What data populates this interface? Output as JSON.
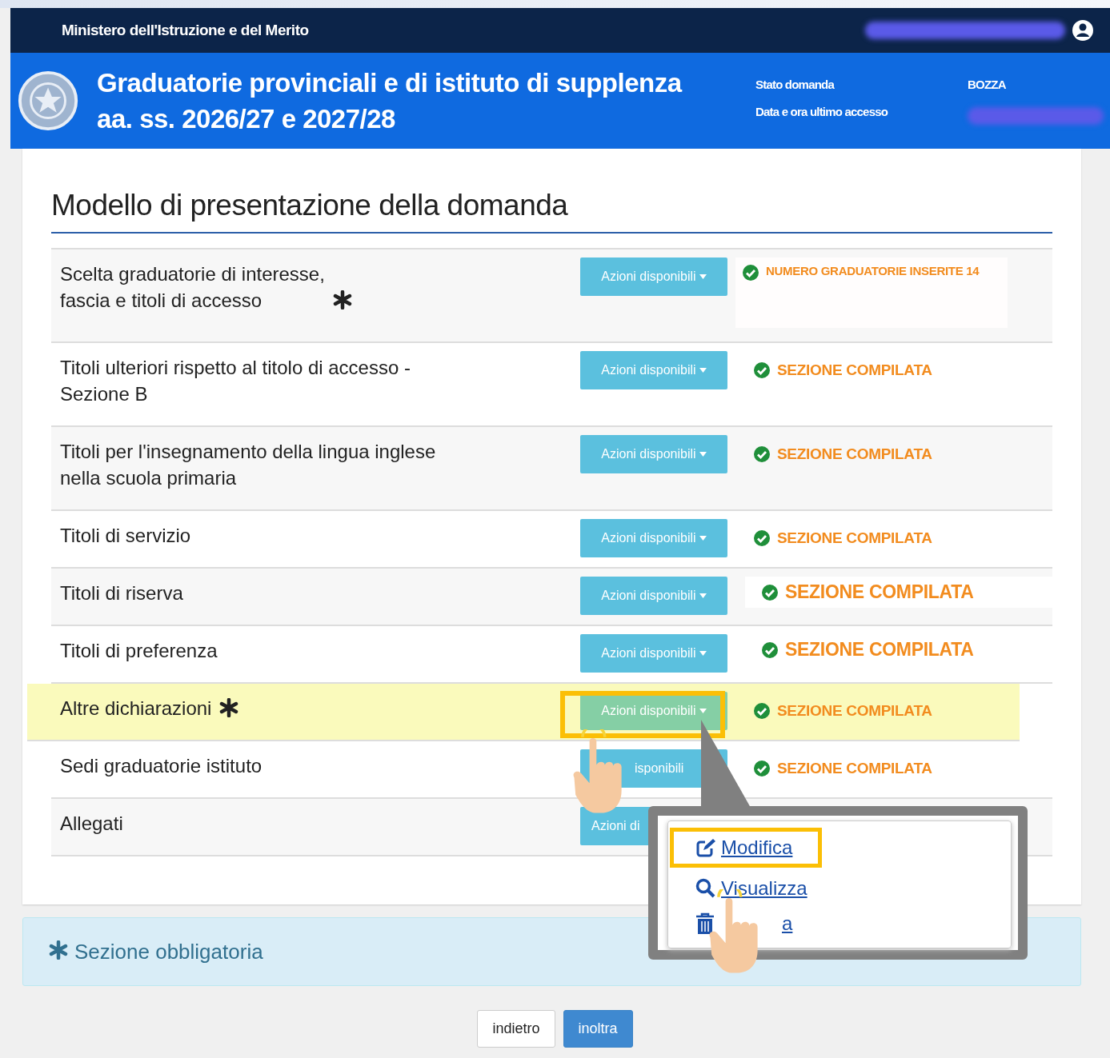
{
  "header": {
    "ministry": "Ministero dell'Istruzione e del Merito",
    "title_lines": [
      "Graduatorie provinciali e di istituto di supplenza",
      "aa. ss. 2026/27 e 2027/28"
    ],
    "status_label": "Stato domanda",
    "status_value": "BOZZA",
    "access_label": "Data e ora ultimo accesso"
  },
  "page_title": "Modello di presentazione della domanda",
  "rows": [
    {
      "label": "Scelta graduatorie di interesse,\nfascia e titoli di accesso",
      "required": true,
      "highlighted": false,
      "button_label": "Azioni disponibili",
      "status": "NUMERO GRADUATORIE INSERITE 14",
      "kind": "count"
    },
    {
      "label": "Titoli ulteriori rispetto al titolo di accesso -\nSezione B",
      "required": false,
      "highlighted": false,
      "button_label": "Azioni disponibili",
      "status": "SEZIONE COMPILATA",
      "kind": "normal"
    },
    {
      "label": "Titoli per l'insegnamento della lingua inglese\nnella scuola primaria",
      "required": false,
      "highlighted": false,
      "button_label": "Azioni disponibili",
      "status": "SEZIONE COMPILATA",
      "kind": "normal"
    },
    {
      "label": "Titoli di servizio",
      "required": false,
      "highlighted": false,
      "button_label": "Azioni disponibili",
      "status": "SEZIONE COMPILATA",
      "kind": "normal"
    },
    {
      "label": "Titoli di riserva",
      "required": false,
      "highlighted": false,
      "button_label": "Azioni disponibili",
      "status": "SEZIONE COMPILATA",
      "kind": "large"
    },
    {
      "label": "Titoli di preferenza",
      "required": false,
      "highlighted": false,
      "button_label": "Azioni disponibili",
      "status": "SEZIONE COMPILATA",
      "kind": "large"
    },
    {
      "label": "Altre dichiarazioni",
      "required": true,
      "highlighted": true,
      "button_label": "Azioni disponibili",
      "status": "SEZIONE COMPILATA",
      "kind": "normal"
    },
    {
      "label": "Sedi graduatorie istituto",
      "required": false,
      "highlighted": false,
      "button_label": "isponibili",
      "status": "SEZIONE COMPILATA",
      "kind": "normal"
    },
    {
      "label": "Allegati",
      "required": false,
      "highlighted": false,
      "button_label": "Azioni di"
    }
  ],
  "callout": {
    "items": [
      {
        "label": "Modifica",
        "highlighted": true
      },
      {
        "label": "Visualizza",
        "highlighted": false
      },
      {
        "label": "a",
        "highlighted": false
      }
    ]
  },
  "legend": "Sezione obbligatoria",
  "buttons": [
    {
      "label": "indietro",
      "kind": "secondary"
    },
    {
      "label": "inoltra",
      "kind": "primary"
    }
  ]
}
